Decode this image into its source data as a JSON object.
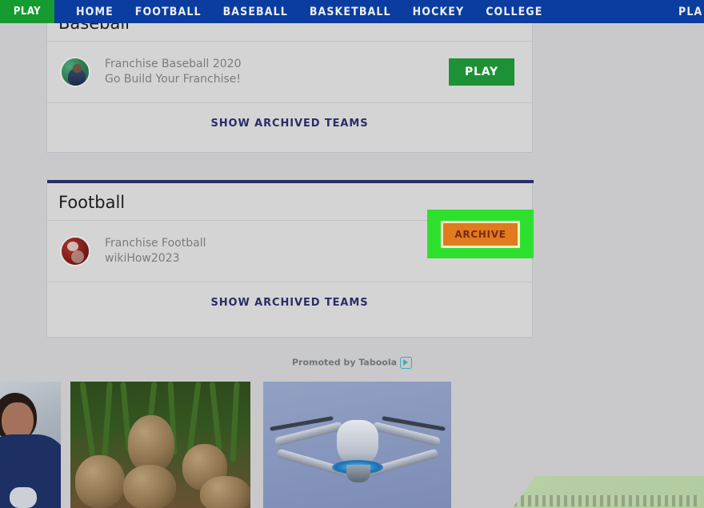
{
  "nav": {
    "play_button": "PLAY",
    "links": [
      "HOME",
      "FOOTBALL",
      "BASEBALL",
      "BASKETBALL",
      "HOCKEY",
      "COLLEGE"
    ],
    "right_link": "PLA",
    "bar_color": "#0b3ca0",
    "play_color": "#159b2f"
  },
  "baseball_section": {
    "title": "Baseball",
    "team": {
      "name": "Franchise Baseball 2020",
      "subtitle": "Go Build Your Franchise!",
      "action_label": "PLAY",
      "action_color": "#1d9135"
    },
    "archived_link": "SHOW ARCHIVED TEAMS"
  },
  "football_section": {
    "title": "Football",
    "divider_color": "#2b2d66",
    "team": {
      "name": "Franchise Football",
      "subtitle": "wikiHow2023",
      "action_label": "ARCHIVE",
      "action_color": "#e07b1e",
      "highlight_color": "#2ee02e"
    },
    "archived_link": "SHOW ARCHIVED TEAMS"
  },
  "taboola": {
    "label": "Promoted by Taboola",
    "icon": "play-triangle-icon",
    "icon_color": "#3fa9b5"
  },
  "ads": [
    {
      "alt": "smiling woman in blue medical scrubs"
    },
    {
      "alt": "harvested celeriac root vegetables with green stalks"
    },
    {
      "alt": "white quadcopter drone flying against blue sky"
    }
  ]
}
